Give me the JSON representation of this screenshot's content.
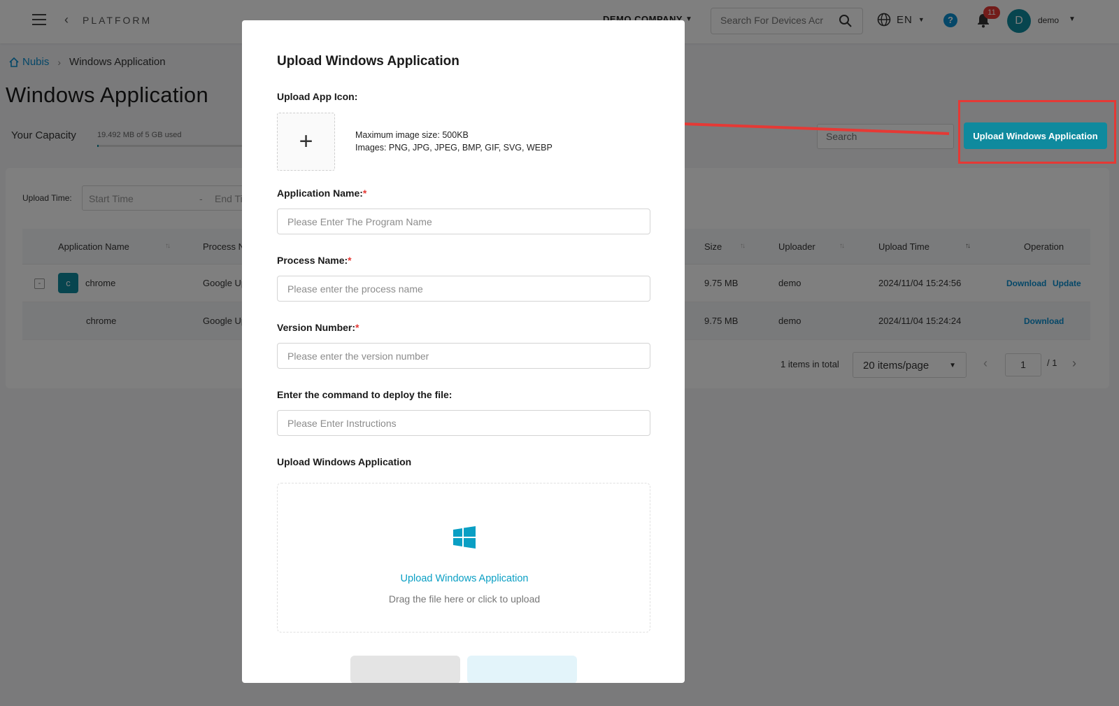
{
  "topbar": {
    "platform_label": "PLATFORM",
    "company": "DEMO COMPANY",
    "search_placeholder": "Search For Devices Acr",
    "language": "EN",
    "notification_count": "11",
    "avatar_letter": "D",
    "username": "demo"
  },
  "breadcrumb": {
    "home": "Nubis",
    "current": "Windows Application"
  },
  "page": {
    "title": "Windows Application",
    "capacity_label": "Your Capacity",
    "capacity_text": "19.492 MB of 5 GB used",
    "capacity_fraction": 0.004,
    "search_placeholder": "Search",
    "upload_button": "Upload Windows Application"
  },
  "filters": {
    "upload_time_label": "Upload Time:",
    "start_placeholder": "Start Time",
    "separator": "-",
    "end_placeholder": "End Ti"
  },
  "table": {
    "headers": {
      "application_name": "Application Name",
      "process_name": "Process N",
      "size": "Size",
      "uploader": "Uploader",
      "upload_time": "Upload Time",
      "operation": "Operation"
    },
    "rows": [
      {
        "expand": "-",
        "icon_letter": "c",
        "name": "chrome",
        "process": "Google Up",
        "size": "9.75 MB",
        "uploader": "demo",
        "upload_time": "2024/11/04 15:24:56",
        "op_download": "Download",
        "op_update": "Update"
      },
      {
        "name": "chrome",
        "process": "Google Up",
        "size": "9.75 MB",
        "uploader": "demo",
        "upload_time": "2024/11/04 15:24:24",
        "op_download": "Download"
      }
    ]
  },
  "pagination": {
    "total": "1 items in total",
    "page_size": "20 items/page",
    "current_page": "1",
    "of_total": "/ 1"
  },
  "modal": {
    "title": "Upload Windows Application",
    "icon_label": "Upload App Icon:",
    "icon_hint_size": "Maximum image size: 500KB",
    "icon_hint_types": "Images: PNG, JPG, JPEG, BMP, GIF, SVG, WEBP",
    "app_name_label": "Application Name:",
    "app_name_placeholder": "Please Enter The Program Name",
    "process_label": "Process Name:",
    "process_placeholder": "Please enter the process name",
    "version_label": "Version Number:",
    "version_placeholder": "Please enter the version number",
    "command_label": "Enter the command to deploy the file:",
    "command_placeholder": "Please Enter Instructions",
    "upload_section_label": "Upload Windows Application",
    "dropzone_title": "Upload Windows Application",
    "dropzone_hint": "Drag the file here or click to upload",
    "required_mark": "*"
  },
  "colors": {
    "accent": "#0f8a9e",
    "link": "#0a8fd0",
    "annotation": "#e53935"
  }
}
